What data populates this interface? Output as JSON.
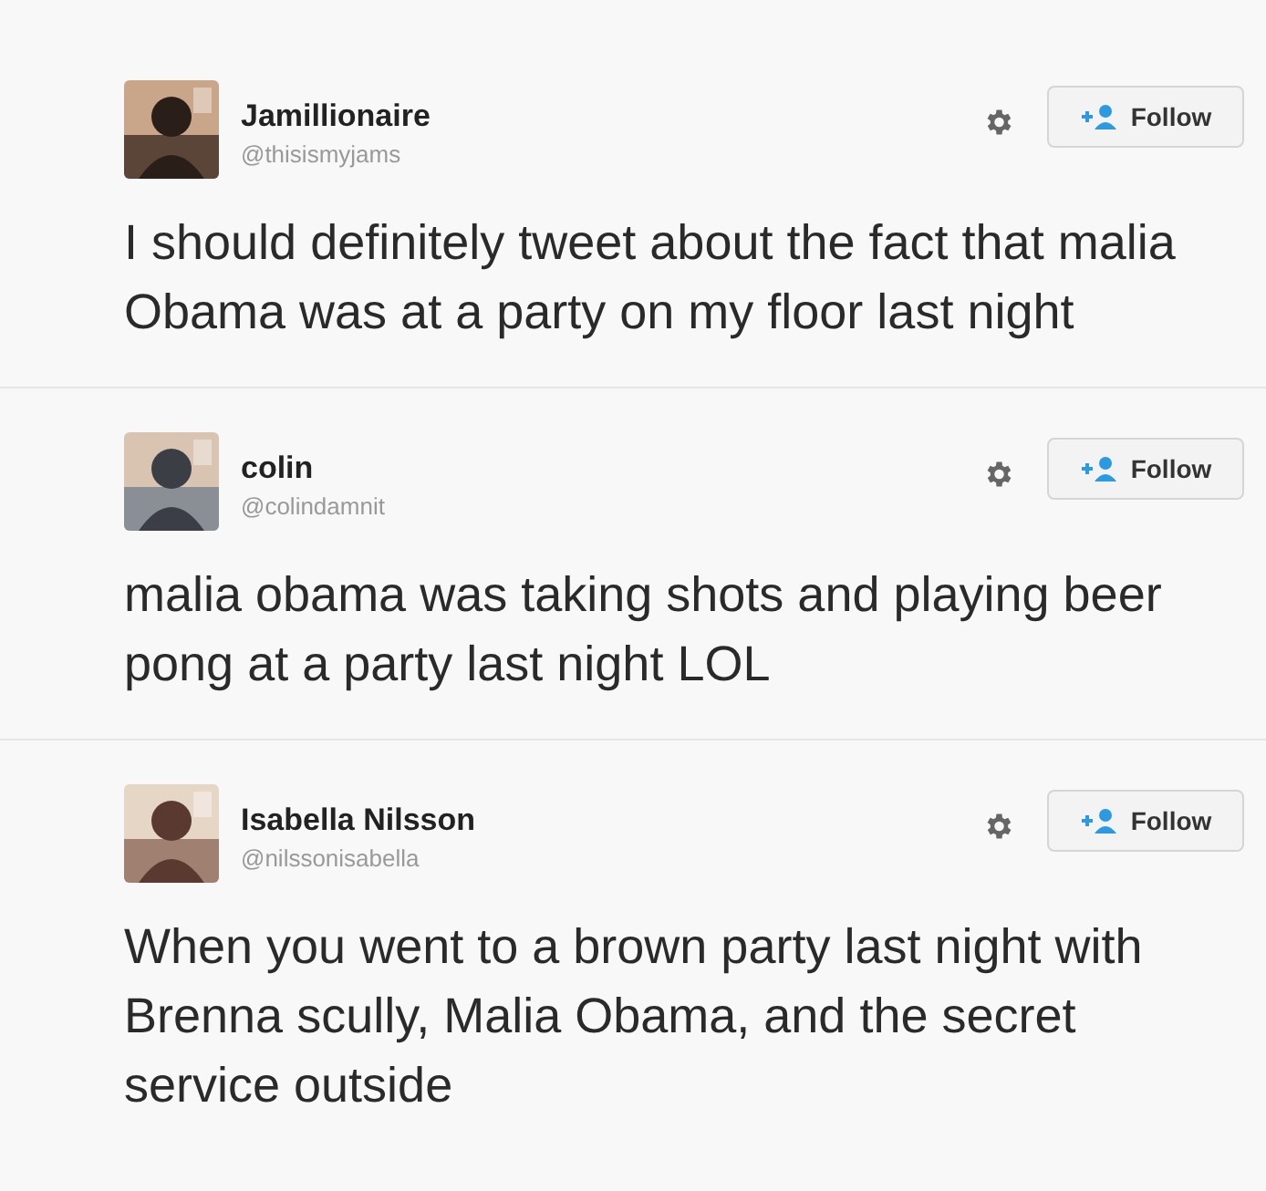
{
  "tweets": [
    {
      "name": "Jamillionaire",
      "handle": "@thisismyjams",
      "follow_label": "Follow",
      "text": "I should definitely tweet about the fact that malia Obama was at a party on my floor last night"
    },
    {
      "name": "colin",
      "handle": "@colindamnit",
      "follow_label": "Follow",
      "text": "malia obama was taking shots and playing beer pong at a party last night LOL"
    },
    {
      "name": "Isabella Nilsson",
      "handle": "@nilssonisabella",
      "follow_label": "Follow",
      "text": "When you went to a brown party last night with Brenna scully, Malia Obama, and the secret service outside"
    }
  ]
}
